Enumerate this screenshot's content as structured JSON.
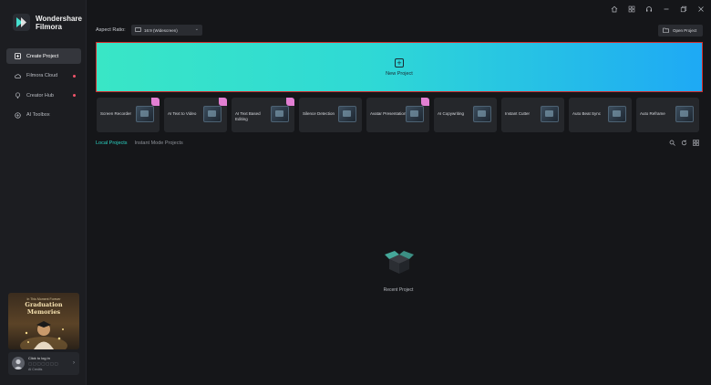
{
  "app": {
    "brand_line1": "Wondershare",
    "brand_line2": "Filmora"
  },
  "sidebar": {
    "items": [
      {
        "label": "Create Project",
        "icon": "film-plus-icon",
        "active": true,
        "dot": false
      },
      {
        "label": "Filmora Cloud",
        "icon": "cloud-icon",
        "active": false,
        "dot": true
      },
      {
        "label": "Creator Hub",
        "icon": "bulb-icon",
        "active": false,
        "dot": true
      },
      {
        "label": "AI Toolbox",
        "icon": "ai-icon",
        "active": false,
        "dot": false
      }
    ],
    "promo": {
      "small": "In This Moment Forever",
      "title_line1": "Graduation",
      "title_line2": "Memories"
    },
    "account": {
      "login": "Click to log in",
      "credits": "AI Credits"
    }
  },
  "toolbar": {
    "aspect_label": "Aspect Ratio:",
    "aspect_value": "16:9 (Widescreen)",
    "open_project": "Open Project"
  },
  "new_project": {
    "label": "New Project"
  },
  "tiles": [
    {
      "label": "Screen Recorder",
      "badge": true
    },
    {
      "label": "AI Text to Video",
      "badge": true
    },
    {
      "label": "AI Text Based Editing",
      "badge": true
    },
    {
      "label": "Silence Detection",
      "badge": false
    },
    {
      "label": "Avatar Presentation",
      "badge": true
    },
    {
      "label": "AI Copywriting",
      "badge": false
    },
    {
      "label": "Instant Cutter",
      "badge": false
    },
    {
      "label": "Auto Beat Sync",
      "badge": false
    },
    {
      "label": "Auto Reframe",
      "badge": false
    }
  ],
  "tabs": [
    {
      "label": "Local Projects",
      "active": true
    },
    {
      "label": "Instant Mode Projects",
      "active": false
    }
  ],
  "empty_state": {
    "label": "Recent Project"
  },
  "colors": {
    "accent": "#2bd4c4",
    "banner_start": "#39e6c6",
    "banner_end": "#1ea9f5",
    "highlight_border": "#d12d2d",
    "badge": "#e27fd3"
  }
}
